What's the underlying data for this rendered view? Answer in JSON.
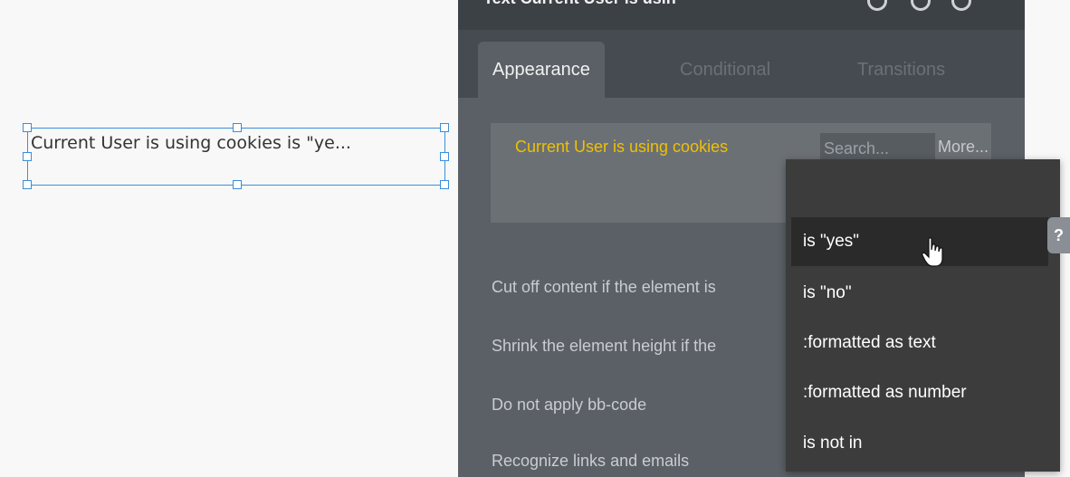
{
  "canvas": {
    "selected_text": "Current User is using cookies is \"ye..."
  },
  "panel": {
    "title": "Text Current User is usin",
    "tabs": [
      {
        "label": "Appearance",
        "active": true
      },
      {
        "label": "Conditional",
        "active": false
      },
      {
        "label": "Transitions",
        "active": false
      }
    ],
    "expression": {
      "label": "Current User is using cookies",
      "search_placeholder": "Search...",
      "more_label": "More..."
    },
    "properties": [
      {
        "label": "Cut off content if the element is"
      },
      {
        "label": "Shrink the element height if the"
      },
      {
        "label": "Do not apply bb-code"
      },
      {
        "label": "Recognize links and emails"
      }
    ]
  },
  "dropdown": {
    "items": [
      {
        "label": "is \"yes\"",
        "hovered": true
      },
      {
        "label": "is \"no\"",
        "hovered": false
      },
      {
        "label": ":formatted as text",
        "hovered": false
      },
      {
        "label": ":formatted as number",
        "hovered": false
      },
      {
        "label": "is not in",
        "hovered": false
      }
    ]
  },
  "help": {
    "label": "?"
  },
  "colors": {
    "selection": "#3a8edb",
    "expression_text": "#f0c000",
    "panel_bg": "#5b6066",
    "dropdown_bg": "#3c3c3c"
  },
  "icons": [
    "title-icon",
    "help-icon",
    "hand-cursor-icon"
  ]
}
